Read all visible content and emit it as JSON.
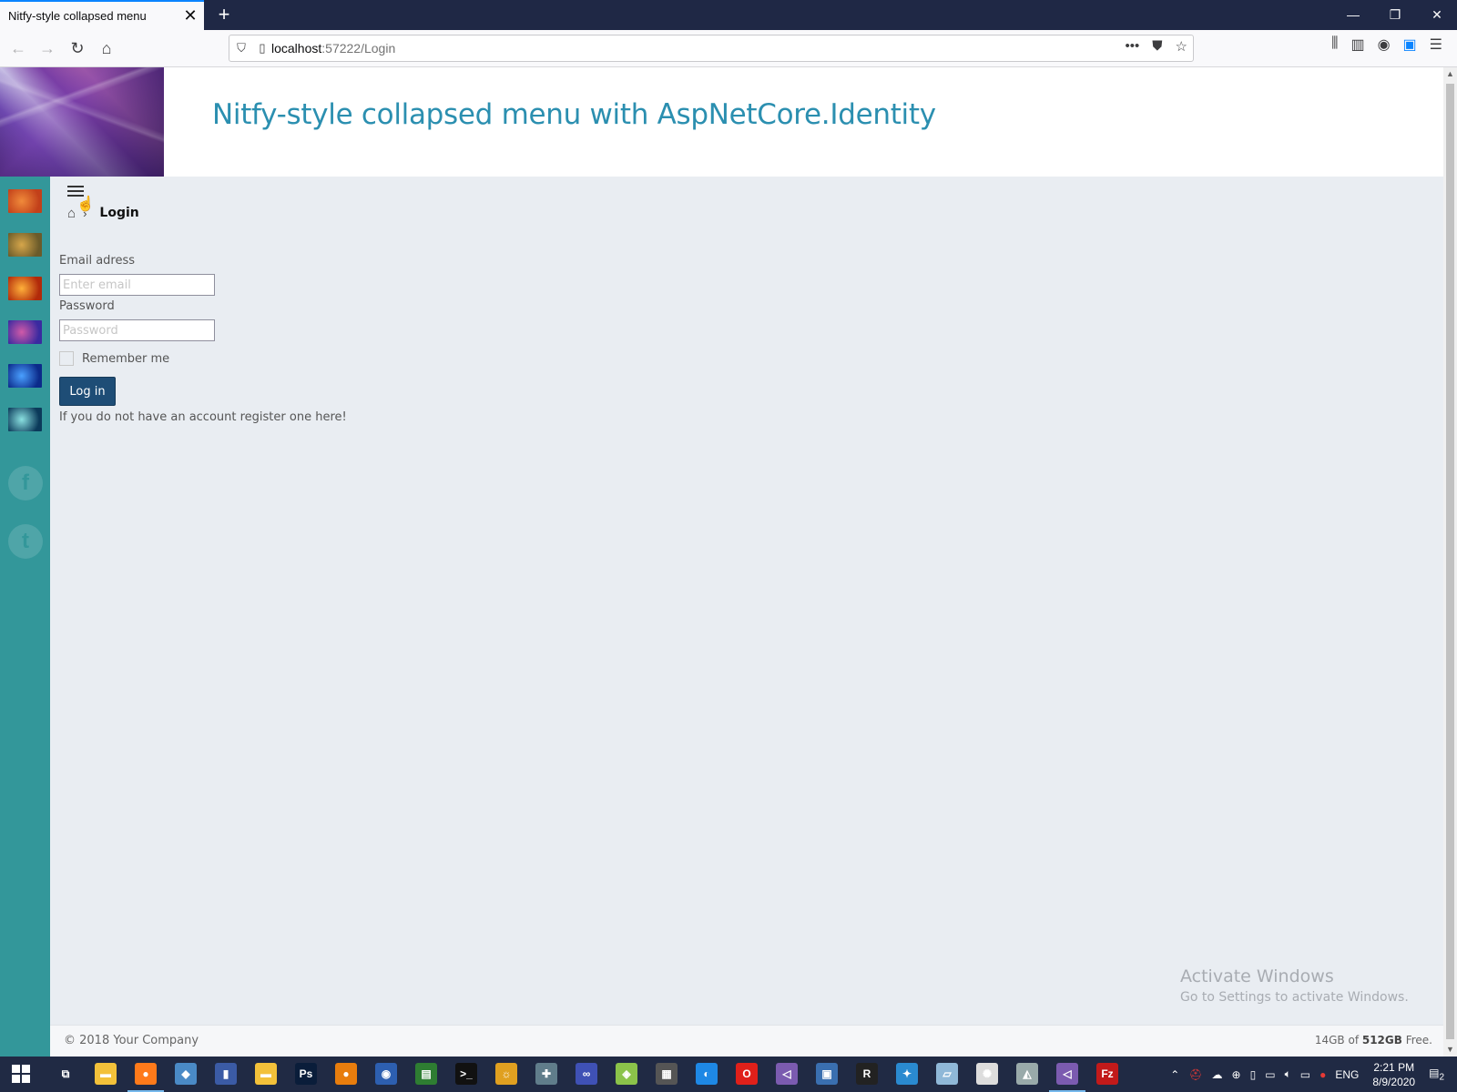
{
  "browser": {
    "tab_title": "Nitfy-style collapsed menu",
    "tab_close": "✕",
    "new_tab": "+",
    "url_host": "localhost",
    "url_path": ":57222/Login",
    "window_controls": {
      "minimize": "—",
      "restore": "❐",
      "close": "✕"
    }
  },
  "page": {
    "site_title": "Nitfy-style collapsed menu with AspNetCore.Identity",
    "breadcrumb": {
      "separator": "›",
      "current": "Login"
    },
    "form": {
      "email_label": "Email adress",
      "email_placeholder": "Enter email",
      "email_value": "",
      "password_label": "Password",
      "password_placeholder": "Password",
      "password_value": "",
      "remember_label": "Remember me",
      "remember_checked": false,
      "submit_label": "Log in",
      "register_text": "If you do not have an account register one here!"
    },
    "sidebar": {
      "thumbnails": [
        {
          "name": "thumb-orange",
          "colors": [
            "#c2401a",
            "#f08a3a"
          ]
        },
        {
          "name": "thumb-gold",
          "colors": [
            "#6b5b2a",
            "#d6a64a"
          ]
        },
        {
          "name": "thumb-fire",
          "colors": [
            "#b12a0a",
            "#ffb03a"
          ]
        },
        {
          "name": "thumb-violet",
          "colors": [
            "#3a2aa0",
            "#d05aa8"
          ]
        },
        {
          "name": "thumb-blue",
          "colors": [
            "#0b2a8a",
            "#4aa0ff"
          ]
        },
        {
          "name": "thumb-teal",
          "colors": [
            "#0b3a5a",
            "#8ae0e0"
          ]
        }
      ],
      "social": [
        {
          "name": "facebook-icon",
          "glyph": "f"
        },
        {
          "name": "twitter-icon",
          "glyph": "t"
        }
      ]
    },
    "footer": {
      "copyright": "© 2018 Your Company",
      "storage_prefix": "14GB of ",
      "storage_total": "512GB",
      "storage_suffix": " Free."
    },
    "watermark": {
      "title": "Activate Windows",
      "subtitle": "Go to Settings to activate Windows."
    }
  },
  "taskbar": {
    "language": "ENG",
    "time": "2:21 PM",
    "date": "8/9/2020",
    "notification_count": "2",
    "apps": [
      {
        "name": "task-view-icon",
        "glyph": "⧉",
        "color": "#202a44"
      },
      {
        "name": "file-explorer-icon",
        "glyph": "▬",
        "color": "#f3c13a"
      },
      {
        "name": "firefox-icon",
        "glyph": "●",
        "color": "#ff7a1a"
      },
      {
        "name": "app-icon-3",
        "glyph": "◆",
        "color": "#4a8ac6"
      },
      {
        "name": "app-icon-4",
        "glyph": "▮",
        "color": "#3b5ba5"
      },
      {
        "name": "folder-icon",
        "glyph": "▬",
        "color": "#f3c13a"
      },
      {
        "name": "photoshop-icon",
        "glyph": "Ps",
        "color": "#0a1d3a"
      },
      {
        "name": "blender-icon",
        "glyph": "●",
        "color": "#e87d0d"
      },
      {
        "name": "app-icon-8",
        "glyph": "◉",
        "color": "#2d5fb0"
      },
      {
        "name": "app-icon-9",
        "glyph": "▤",
        "color": "#2e7d32"
      },
      {
        "name": "terminal-icon",
        "glyph": ">_",
        "color": "#111"
      },
      {
        "name": "app-icon-11",
        "glyph": "☼",
        "color": "#e0a020"
      },
      {
        "name": "app-icon-12",
        "glyph": "✚",
        "color": "#607d8b"
      },
      {
        "name": "app-icon-13",
        "glyph": "∞",
        "color": "#3f51b5"
      },
      {
        "name": "app-icon-14",
        "glyph": "◈",
        "color": "#8bc34a"
      },
      {
        "name": "app-icon-15",
        "glyph": "▦",
        "color": "#555"
      },
      {
        "name": "app-icon-16",
        "glyph": "◐",
        "color": "#1e88e5"
      },
      {
        "name": "opera-icon",
        "glyph": "O",
        "color": "#e0201a"
      },
      {
        "name": "visual-studio-icon",
        "glyph": "◁",
        "color": "#7b5bb0"
      },
      {
        "name": "app-icon-19",
        "glyph": "▣",
        "color": "#3a6fb0"
      },
      {
        "name": "app-icon-20",
        "glyph": "R",
        "color": "#222"
      },
      {
        "name": "app-icon-21",
        "glyph": "✦",
        "color": "#2a8ad0"
      },
      {
        "name": "app-icon-22",
        "glyph": "▱",
        "color": "#8fb8d8"
      },
      {
        "name": "app-icon-23",
        "glyph": "✺",
        "color": "#ddd"
      },
      {
        "name": "app-icon-24",
        "glyph": "◭",
        "color": "#9aa"
      },
      {
        "name": "visual-studio-2-icon",
        "glyph": "◁",
        "color": "#7b5bb0"
      },
      {
        "name": "filezilla-icon",
        "glyph": "Fz",
        "color": "#c21a1a"
      }
    ]
  }
}
